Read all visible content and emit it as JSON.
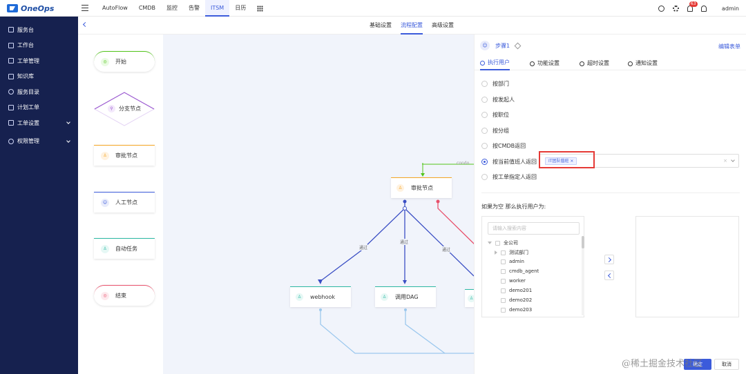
{
  "app": {
    "logo": "OneOps"
  },
  "topnav": {
    "items": [
      "AutoFlow",
      "CMDB",
      "监控",
      "告警",
      "ITSM",
      "日历"
    ],
    "active_index": 4,
    "badge_count": "63",
    "user": "admin"
  },
  "sidebar": {
    "items": [
      {
        "label": "服务台",
        "icon": "desk-icon"
      },
      {
        "label": "工作台",
        "icon": "workbench-icon"
      },
      {
        "label": "工单管理",
        "icon": "ticket-icon"
      },
      {
        "label": "知识库",
        "icon": "book-icon"
      },
      {
        "label": "服务目录",
        "icon": "catalog-icon"
      },
      {
        "label": "计划工单",
        "icon": "calendar-icon"
      },
      {
        "label": "工单设置",
        "icon": "settings-icon",
        "expandable": true
      },
      {
        "label": "权限管理",
        "icon": "shield-icon",
        "expandable": true
      }
    ]
  },
  "subtabs": {
    "items": [
      "基础设置",
      "流程配置",
      "高级设置"
    ],
    "active_index": 1
  },
  "palette": {
    "nodes": [
      {
        "label": "开始",
        "color": "#52c41a"
      },
      {
        "label": "分支节点",
        "color": "#9b59d0"
      },
      {
        "label": "审批节点",
        "color": "#f5a623"
      },
      {
        "label": "人工节点",
        "color": "#3b5bdb"
      },
      {
        "label": "自动任务",
        "color": "#2bb8a3"
      },
      {
        "label": "结束",
        "color": "#e8506b"
      }
    ]
  },
  "canvas": {
    "approval_node": "审批节点",
    "webhook_node": "webhook",
    "dag_node": "调用DAG",
    "edge_pass_labels": [
      "通过",
      "通过",
      "通过"
    ],
    "edge_top_label": "condo"
  },
  "panel": {
    "step_title": "步骤1",
    "edit_form": "编辑表单",
    "tabs": [
      "执行用户",
      "功能设置",
      "超时设置",
      "通知设置"
    ],
    "active_tab": 0,
    "options": [
      "按部门",
      "按发起人",
      "按职位",
      "按分组",
      "按CMDB返回",
      "按当前值班人返回",
      "按工单指定人返回"
    ],
    "selected_option": 5,
    "tag": "IT团队值班",
    "empty_label": "如果为空 那么执行用户为:",
    "search_placeholder": "请输入搜索内容",
    "tree": {
      "root": "全公司",
      "child": "测试部门",
      "users": [
        "admin",
        "cmdb_agent",
        "worker",
        "demo201",
        "demo202",
        "demo203"
      ]
    },
    "confirm": "确定",
    "cancel": "取消"
  },
  "watermark": "@稀土掘金技术社区",
  "colors": {
    "sidebar_bg": "#16214f",
    "accent": "#3b5bdb",
    "canvas_bg": "#f1f4fb",
    "highlight": "#e53935"
  }
}
